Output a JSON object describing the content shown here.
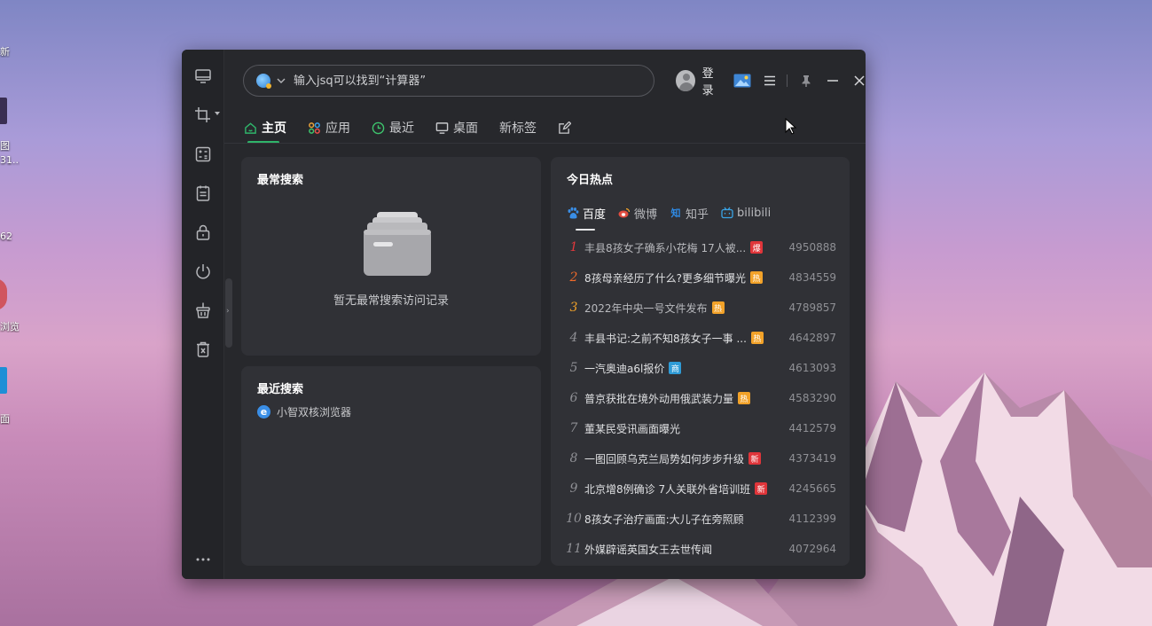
{
  "desktop": {
    "labels": [
      "新",
      "图",
      "31...",
      "62",
      "浏览",
      "面"
    ]
  },
  "search": {
    "placeholder": "输入jsq可以找到“计算器”"
  },
  "user": {
    "login_label": "登录"
  },
  "tabs": [
    {
      "label": "主页",
      "icon": "home-icon",
      "active": true
    },
    {
      "label": "应用",
      "icon": "apps-icon",
      "active": false
    },
    {
      "label": "最近",
      "icon": "clock-icon",
      "active": false
    },
    {
      "label": "桌面",
      "icon": "monitor-icon",
      "active": false
    },
    {
      "label": "新标签",
      "icon": "",
      "active": false
    }
  ],
  "frequent": {
    "title": "最常搜索",
    "empty_text": "暂无最常搜索访问记录"
  },
  "recent": {
    "title": "最近搜索",
    "items": [
      {
        "label": "小智双核浏览器",
        "icon": "browser-icon"
      }
    ]
  },
  "hot": {
    "title": "今日热点",
    "sources": [
      {
        "label": "百度",
        "icon": "baidu-icon",
        "active": true
      },
      {
        "label": "微博",
        "icon": "weibo-icon",
        "active": false
      },
      {
        "label": "知乎",
        "icon": "zhihu-icon",
        "active": false
      },
      {
        "label": "bilibili",
        "icon": "bilibili-icon",
        "active": false
      }
    ],
    "items": [
      {
        "rank": "1",
        "title": "丰县8孩女子确系小花梅 17人被...",
        "badge": "爆",
        "badge_color": "#e0353a",
        "count": "4950888",
        "dim": true
      },
      {
        "rank": "2",
        "title": "8孩母亲经历了什么?更多细节曝光",
        "badge": "热",
        "badge_color": "#f2a229",
        "count": "4834559",
        "dim": false
      },
      {
        "rank": "3",
        "title": "2022年中央一号文件发布",
        "badge": "热",
        "badge_color": "#f2a229",
        "count": "4789857",
        "dim": true
      },
      {
        "rank": "4",
        "title": "丰县书记:之前不知8孩女子一事 ...",
        "badge": "热",
        "badge_color": "#f2a229",
        "count": "4642897",
        "dim": false
      },
      {
        "rank": "5",
        "title": "一汽奥迪a6l报价",
        "badge": "商",
        "badge_color": "#2f9bd6",
        "count": "4613093",
        "dim": false
      },
      {
        "rank": "6",
        "title": "普京获批在境外动用俄武装力量",
        "badge": "热",
        "badge_color": "#f2a229",
        "count": "4583290",
        "dim": false
      },
      {
        "rank": "7",
        "title": "董某民受讯画面曝光",
        "badge": "",
        "badge_color": "",
        "count": "4412579",
        "dim": false
      },
      {
        "rank": "8",
        "title": "一图回顾乌克兰局势如何步步升级",
        "badge": "新",
        "badge_color": "#e0353a",
        "count": "4373419",
        "dim": false
      },
      {
        "rank": "9",
        "title": "北京增8例确诊 7人关联外省培训班",
        "badge": "新",
        "badge_color": "#e0353a",
        "count": "4245665",
        "dim": false
      },
      {
        "rank": "10",
        "title": "8孩女子治疗画面:大儿子在旁照顾",
        "badge": "",
        "badge_color": "",
        "count": "4112399",
        "dim": false
      },
      {
        "rank": "11",
        "title": "外媒辟谣英国女王去世传闻",
        "badge": "",
        "badge_color": "",
        "count": "4072964",
        "dim": false
      }
    ]
  },
  "colors": {
    "accent": "#2fb46a",
    "window_bg": "#27282c",
    "card_bg": "#303136"
  }
}
